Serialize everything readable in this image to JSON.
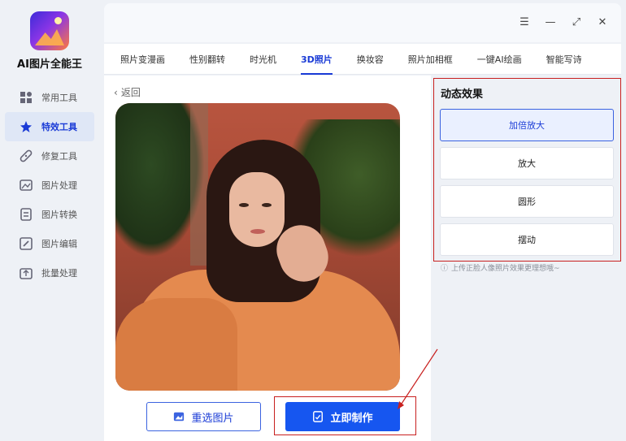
{
  "app": {
    "name": "AI图片全能王"
  },
  "sidebar": {
    "items": [
      {
        "label": "常用工具",
        "icon": "grid-icon",
        "active": false
      },
      {
        "label": "特效工具",
        "icon": "star-icon",
        "active": true
      },
      {
        "label": "修复工具",
        "icon": "bandage-icon",
        "active": false
      },
      {
        "label": "图片处理",
        "icon": "image-icon",
        "active": false
      },
      {
        "label": "图片转换",
        "icon": "convert-icon",
        "active": false
      },
      {
        "label": "图片编辑",
        "icon": "edit-icon",
        "active": false
      },
      {
        "label": "批量处理",
        "icon": "batch-icon",
        "active": false
      }
    ]
  },
  "window_controls": [
    "menu-icon",
    "minimize-icon",
    "maximize-icon",
    "close-icon"
  ],
  "tabs": [
    {
      "label": "照片变漫画",
      "active": false
    },
    {
      "label": "性别翻转",
      "active": false
    },
    {
      "label": "时光机",
      "active": false
    },
    {
      "label": "3D照片",
      "active": true
    },
    {
      "label": "换妆容",
      "active": false
    },
    {
      "label": "照片加相框",
      "active": false
    },
    {
      "label": "一键AI绘画",
      "active": false
    },
    {
      "label": "智能写诗",
      "active": false
    }
  ],
  "main": {
    "back_label": "返回",
    "reselect_label": "重选图片",
    "make_label": "立即制作"
  },
  "panel": {
    "title": "动态效果",
    "effects": [
      {
        "label": "加倍放大",
        "selected": true
      },
      {
        "label": "放大",
        "selected": false
      },
      {
        "label": "圆形",
        "selected": false
      },
      {
        "label": "摆动",
        "selected": false
      }
    ],
    "tip": "上传正脸人像照片效果更理想哦~"
  },
  "colors": {
    "accent": "#1656f0",
    "highlight": "#c8201f",
    "active_tab": "#1a3bd6"
  }
}
